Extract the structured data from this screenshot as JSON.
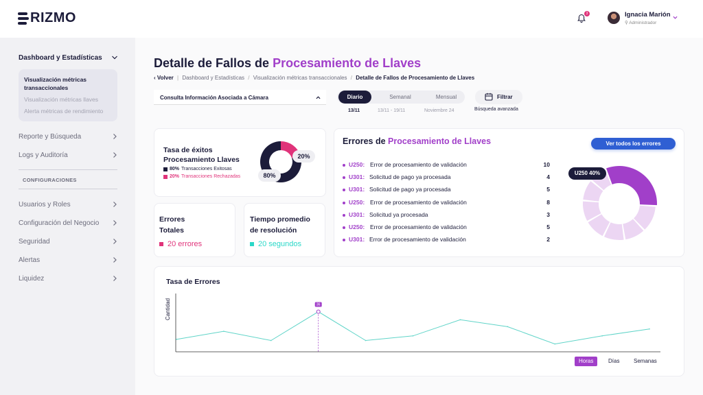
{
  "brand": {
    "name": "RIZMO"
  },
  "header": {
    "notifications_count": "3",
    "user_name": "Ignacia Marión",
    "user_role": "Administrador"
  },
  "sidebar": {
    "dashboard": {
      "label": "Dashboard y Estadísticas",
      "items": [
        {
          "label": "Visualización métricas transaccionales",
          "active": true
        },
        {
          "label": "Visualización métricas llaves"
        },
        {
          "label": "Alerta métricas de rendimiento"
        }
      ]
    },
    "sections": [
      {
        "label": "Reporte y Búsqueda"
      },
      {
        "label": "Logs y Auditoría"
      }
    ],
    "config_label": "CONFIGURACIONES",
    "config_sections": [
      {
        "label": "Usuarios y Roles"
      },
      {
        "label": "Configuración del Negocio"
      },
      {
        "label": "Seguridad"
      },
      {
        "label": "Alertas"
      },
      {
        "label": "Liquidez"
      }
    ]
  },
  "page": {
    "title_prefix": "Detalle de Fallos de ",
    "title_accent": "Procesamiento de Llaves",
    "breadcrumb": {
      "back": "Volver",
      "items": [
        "Dashboard y Estadísticas",
        "Visualización métricas transaccionales"
      ],
      "current": "Detalle de Fallos de Procesamiento de Llaves"
    }
  },
  "filters": {
    "camera_select": "Consulta Información Asociada a Cámara",
    "periods": [
      {
        "label": "Diario",
        "sub": "13/11",
        "active": true
      },
      {
        "label": "Semanal",
        "sub": "13/11 - 19/11"
      },
      {
        "label": "Mensual",
        "sub": "Noviembre 24"
      }
    ],
    "filter_label": "Filtrar",
    "filter_sub": "Búsqueda avanzada"
  },
  "success_rate": {
    "title": "Tasa de éxitos Procesamiento Llaves",
    "success_pct": "80%",
    "success_label": "Transacciones Exitosas",
    "reject_pct": "20%",
    "reject_label": "Transacciones Rechazadas",
    "success_value": 80,
    "reject_value": 20,
    "colors": {
      "success": "#1c1c3a",
      "reject": "#e0337a"
    }
  },
  "total_errors": {
    "title_line1": "Errores",
    "title_line2": "Totales",
    "value": "20 errores",
    "color": "#e0337a"
  },
  "resolution_time": {
    "title_line1": "Tiempo promedio",
    "title_line2": "de resolución",
    "value": "20 segundos",
    "color": "#2ad8c8"
  },
  "errors_panel": {
    "title_prefix": "Errores de ",
    "title_accent": "Procesamiento de Llaves",
    "button": "Ver todos los errores",
    "rows": [
      {
        "code": "U250:",
        "desc": "Error de procesamiento de validación",
        "count": "10"
      },
      {
        "code": "U301:",
        "desc": "Solicitud de pago ya procesada",
        "count": "4"
      },
      {
        "code": "U301:",
        "desc": "Solicitud de pago ya procesada",
        "count": "5"
      },
      {
        "code": "U250:",
        "desc": "Error de procesamiento de validación",
        "count": "8"
      },
      {
        "code": "U301:",
        "desc": "Solicitud ya procesada",
        "count": "3"
      },
      {
        "code": "U250:",
        "desc": "Error de procesamiento de validación",
        "count": "5"
      },
      {
        "code": "U301:",
        "desc": "Error de procesamiento de validación",
        "count": "2"
      }
    ],
    "highlight": "U250 40%",
    "donut_segments": [
      40,
      15,
      12,
      12,
      12,
      12,
      12,
      10
    ],
    "colors": {
      "highlight": "#a13fc9",
      "rest": "#ecd6f3"
    }
  },
  "error_rate": {
    "title": "Tasa de Errores",
    "ylabel": "Cantidad",
    "marker_label": "36",
    "ranges": [
      {
        "label": "Horas",
        "active": true
      },
      {
        "label": "Días"
      },
      {
        "label": "Semanas"
      }
    ]
  },
  "chart_data": {
    "type": "line",
    "title": "Tasa de Errores",
    "xlabel": "",
    "ylabel": "Cantidad",
    "x": [
      1,
      2,
      3,
      4,
      5,
      6,
      7,
      8,
      9,
      10,
      11
    ],
    "series": [
      {
        "values": [
          12,
          19,
          11,
          36,
          11,
          15,
          29,
          23,
          8,
          15,
          21
        ]
      }
    ],
    "ylim": [
      0,
      50
    ],
    "color": "#5fd4c8",
    "highlight_index": 3
  }
}
